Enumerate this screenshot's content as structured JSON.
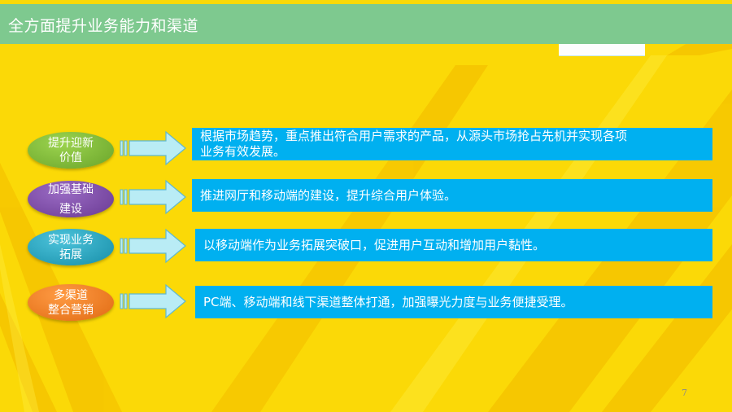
{
  "slide": {
    "title": "全方面提升业务能力和渠道",
    "page_number": "7",
    "rows": [
      {
        "label_line1": "提升迎新",
        "label_line2": "价值",
        "text_line1": "根据市场趋势，重点推出符合用户需求的产品，从源头市场抢占先机并实现各项",
        "text_line2": "业务有效发展。"
      },
      {
        "label_line1": "加强基础",
        "label_line2": "建设",
        "text_line1": "推进网厅和移动端的建设，提升综合用户体验。",
        "text_line2": ""
      },
      {
        "label_line1": "实现业务",
        "label_line2": "拓展",
        "text_line1": "以移动端作为业务拓展突破口，促进用户互动和增加用户黏性。",
        "text_line2": ""
      },
      {
        "label_line1": "多渠道",
        "label_line2": "整合营销",
        "text_line1": "PC端、移动端和线下渠道整体打通，加强曝光力度与业务便捷受理。",
        "text_line2": ""
      }
    ]
  },
  "colors": {
    "background": "#fbd907",
    "stripe": "#f7c600",
    "title_bar": "#7ec98f",
    "text_box": "#00b0f0",
    "pill_green": "#7cb83a",
    "pill_purple": "#7b4aa4",
    "pill_teal": "#21a4c0",
    "pill_orange": "#ef7d22",
    "arrow_fill": "#b9ecf5"
  }
}
